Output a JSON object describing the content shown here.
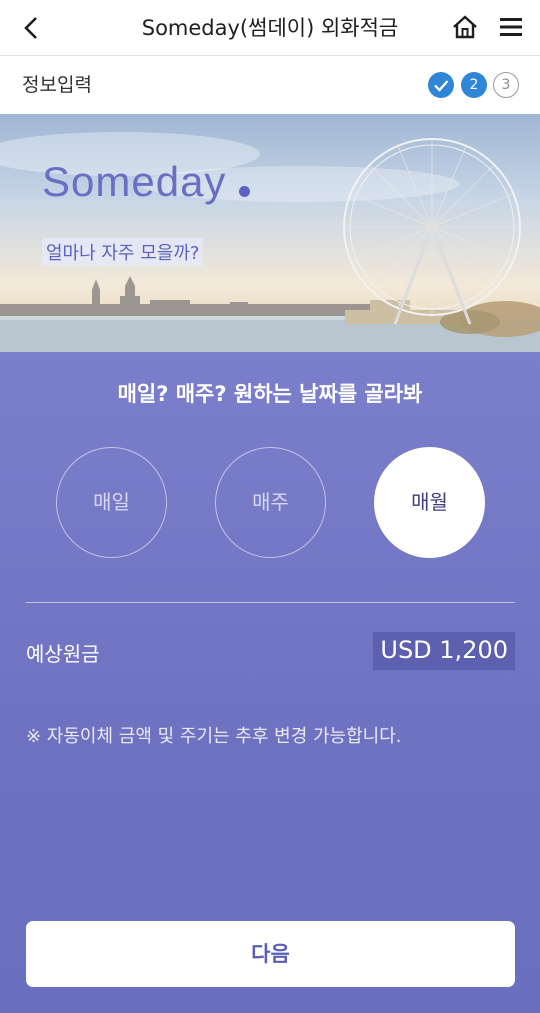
{
  "header": {
    "title": "Someday(썸데이) 외화적금",
    "back_icon": "chevron-left-icon",
    "home_icon": "home-icon",
    "menu_icon": "hamburger-menu-icon"
  },
  "steps": {
    "title": "정보입력",
    "step1": "",
    "step2": "2",
    "step3": "3",
    "current": 2,
    "total": 3
  },
  "hero": {
    "brand": "Someday",
    "subtitle": "얼마나 자주 모을까?"
  },
  "main": {
    "question": "매일? 매주? 원하는 날짜를 골라봐",
    "options": [
      {
        "label": "매일",
        "selected": false
      },
      {
        "label": "매주",
        "selected": false
      },
      {
        "label": "매월",
        "selected": true
      }
    ],
    "estimate_label": "예상원금",
    "estimate_value": "USD 1,200",
    "notice": "※ 자동이체 금액 및 주기는 추후 변경 가능합니다.",
    "next_label": "다음"
  },
  "colors": {
    "accent": "#6f72c2",
    "step_active": "#2f86d6",
    "button_text": "#5a5fb3"
  }
}
